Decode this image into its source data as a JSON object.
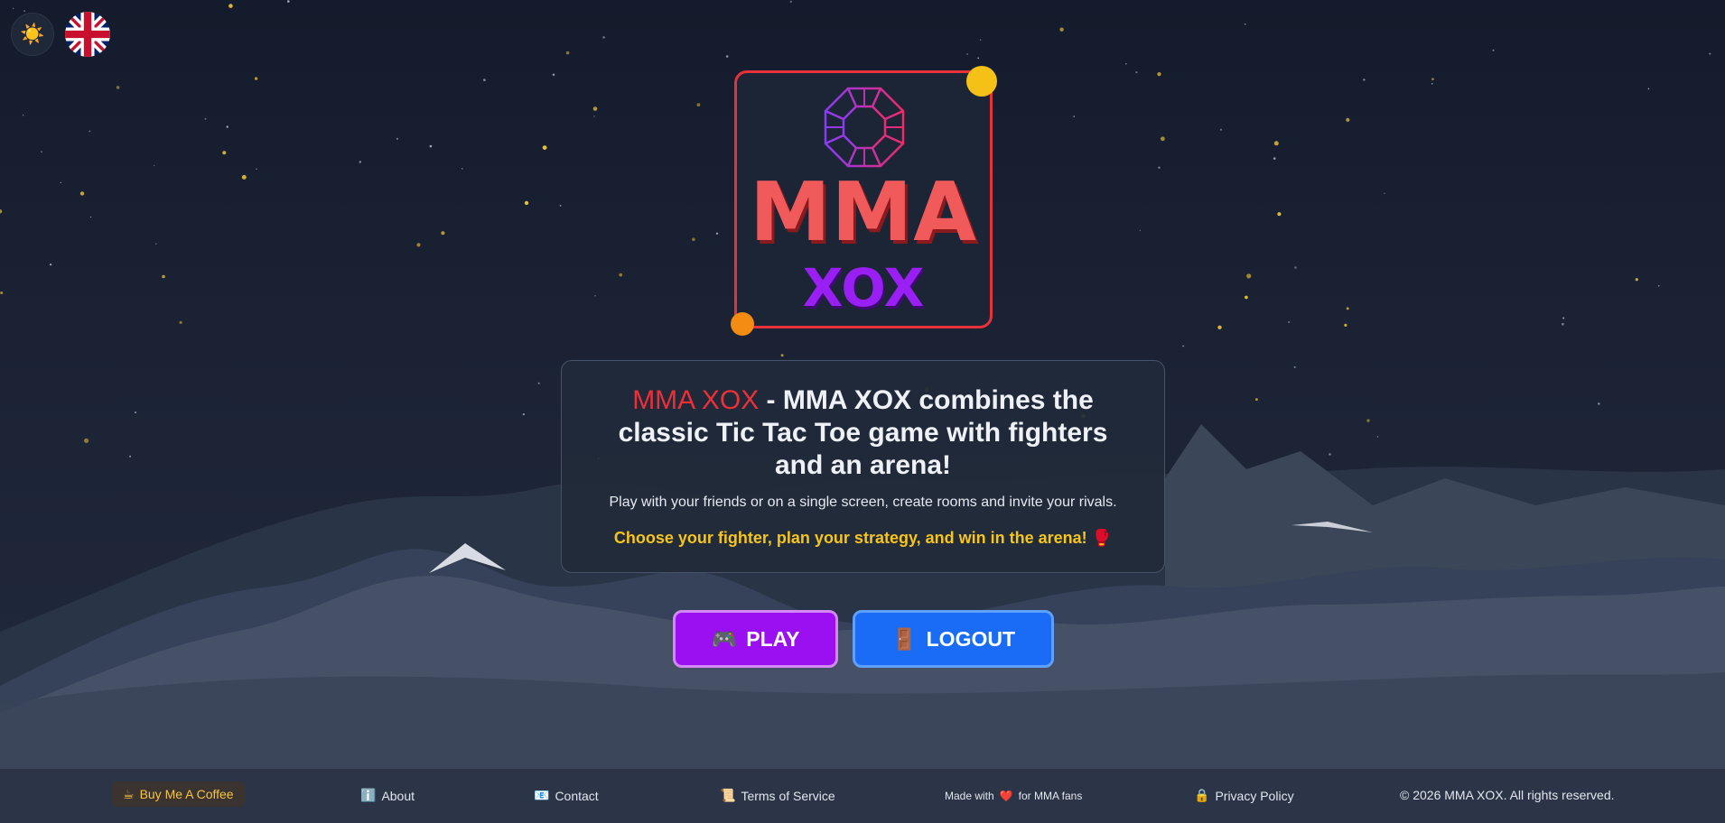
{
  "top_controls": {
    "theme_icon": "☀️",
    "language_flag": "united-kingdom-flag"
  },
  "logo": {
    "title": "MMA",
    "subtitle": "XOX",
    "emblem": "octagon-cage-icon"
  },
  "info": {
    "brand": "MMA XOX",
    "title_rest": " - MMA XOX combines the classic Tic Tac Toe game with fighters and an arena!",
    "description": "Play with your friends or on a single screen, create rooms and invite your rivals.",
    "cta": "Choose your fighter, plan your strategy, and win in the arena! 🥊"
  },
  "buttons": {
    "play_icon": "🎮",
    "play_label": "PLAY",
    "logout_icon": "🚪",
    "logout_label": "LOGOUT"
  },
  "footer": {
    "coffee_icon": "☕",
    "coffee_label": "Buy Me A Coffee",
    "about_icon": "ℹ️",
    "about_label": "About",
    "contact_icon": "📧",
    "contact_label": "Contact",
    "terms_icon": "📜",
    "terms_label": "Terms of Service",
    "made_prefix": "Made with",
    "made_heart": "❤️",
    "made_suffix": "for MMA fans",
    "privacy_icon": "🔒",
    "privacy_label": "Privacy Policy",
    "copyright": "© 2026 MMA XOX. All rights reserved."
  },
  "colors": {
    "brand_red": "#ee2f36",
    "logo_purple": "#9a1ff5",
    "cta_yellow": "#f7c51a",
    "play_purple": "#9a10f0",
    "logout_blue": "#1a6cf6",
    "footer_bg": "#2b3547"
  }
}
